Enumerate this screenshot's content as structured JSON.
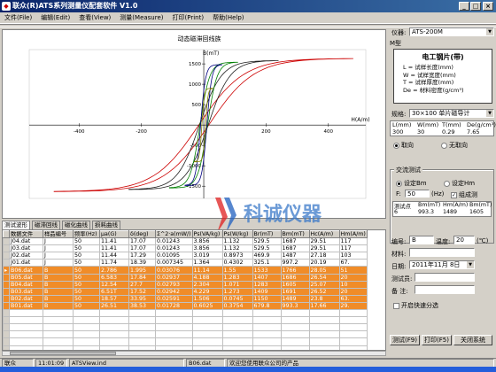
{
  "window": {
    "title": "联众(R)ATS系列测量仪配套软件 V1.0"
  },
  "menu": [
    "文件(File)",
    "编辑(Edit)",
    "查看(View)",
    "测量(Measure)",
    "打印(Print)",
    "帮助(Help)"
  ],
  "chart": {
    "title": "动态磁滞回线族",
    "y_axis_label": "B(mT)",
    "x_axis_label": "H(A/m)",
    "x_ticks": [
      "-400",
      "-200",
      "200",
      "400"
    ],
    "y_ticks": [
      "1500",
      "1000",
      "500",
      "-500",
      "-1000",
      "-1500"
    ]
  },
  "chart_data": {
    "type": "line",
    "title": "动态磁滞回线族",
    "xlabel": "H(A/m)",
    "ylabel": "B(mT)",
    "xlim": [
      -560,
      520
    ],
    "ylim": [
      -1800,
      1850
    ],
    "series": [
      {
        "Hm": 480,
        "Hc": 16,
        "Bm": 1630,
        "color": "#cc0000"
      },
      {
        "Hm": 240,
        "Hc": 14,
        "Bm": 1580,
        "color": "#202020"
      },
      {
        "Hm": 110,
        "Hc": 12,
        "Bm": 1540,
        "color": "#008000"
      },
      {
        "Hm": 60,
        "Hc": 10,
        "Bm": 1480,
        "color": "#000080"
      },
      {
        "Hm": 30,
        "Hc": 6,
        "Bm": 900,
        "color": "#808000"
      }
    ]
  },
  "watermark": {
    "brand": "科诚仪器",
    "company": "宁波北仑区科诚仪器有限公司"
  },
  "tabs": [
    "测试波形",
    "磁滞回线",
    "磁化曲线",
    "损耗曲线"
  ],
  "table": {
    "headers": [
      "数据文件",
      "样品编号",
      "频率(Hz)",
      "μa(G)",
      "δ(deg)",
      "Σ^2·a(mW/)",
      "Ps(VA/kg)",
      "Ps(W/kg)",
      "Br(mT)",
      "Bm(mT)",
      "Hc(A/m)",
      "Hm(A/m)"
    ],
    "rows": [
      [
        "J04.dat",
        "J",
        "50",
        "11.41",
        "17.07",
        "0.01243",
        "3.856",
        "1.132",
        "529.5",
        "1687",
        "29.51",
        "117"
      ],
      [
        "J03.dat",
        "J",
        "50",
        "11.41",
        "17.07",
        "0.01243",
        "3.856",
        "1.132",
        "529.5",
        "1687",
        "29.51",
        "117"
      ],
      [
        "J02.dat",
        "J",
        "50",
        "11.44",
        "17.29",
        "0.01095",
        "3.019",
        "0.8973",
        "469.9",
        "1487",
        "27.18",
        "103"
      ],
      [
        "J01.dat",
        "J",
        "50",
        "11.74",
        "18.39",
        "0.007345",
        "1.364",
        "0.4302",
        "325.1",
        "997.2",
        "20.19",
        "67."
      ],
      [
        "B06.dat",
        "B",
        "50",
        "2.786",
        "1.995",
        "0.03076",
        "11.14",
        "1.55",
        "1533",
        "1766",
        "28.05",
        "51"
      ],
      [
        "B05.dat",
        "B",
        "50",
        "6.583",
        "17.84",
        "0.02937",
        "4.188",
        "1.283",
        "1407",
        "1686",
        "26.54",
        "20"
      ],
      [
        "B04.dat",
        "B",
        "50",
        "12.54",
        "27.7",
        "0.02793",
        "2.304",
        "1.071",
        "1283",
        "1605",
        "25.07",
        "10"
      ],
      [
        "B03.dat",
        "B",
        "50",
        "6.51T",
        "17.52",
        "0.02942",
        "4.229",
        "1.273",
        "1409",
        "1691",
        "26.52",
        "20"
      ],
      [
        "B02.dat",
        "B",
        "50",
        "18.57",
        "33.95",
        "0.02591",
        "1.506",
        "0.0745",
        "1150",
        "1489",
        "23.8",
        "63."
      ],
      [
        "B01.dat",
        "B",
        "50",
        "26.51",
        "38.53",
        "0.01728",
        "0.6025",
        "0.3754",
        "679.8",
        "993.3",
        "17.66",
        "29."
      ]
    ],
    "selected_rows": [
      4,
      5,
      6,
      7,
      8,
      9
    ]
  },
  "right": {
    "instrument_label": "仪器:",
    "instrument_value": "ATS-200M",
    "section_label": "M型",
    "param_title": "电工钢片(带)",
    "param_lines": [
      "L = 试样长度(mm)",
      "W = 试样宽度(mm)",
      "T = 试样厚度(mm)",
      "De = 材料密度(g/cm³)"
    ],
    "spec_label": "规格:",
    "spec_value": "30×100 单片磁导计",
    "dim_headers": [
      "L(mm)",
      "W(mm)",
      "T(mm)",
      "De(g/cm³)"
    ],
    "dim_values": [
      "300",
      "30",
      "0.29",
      "7.65"
    ],
    "orient_options": [
      "取向",
      "无取向"
    ],
    "ac_group": "交流测试",
    "set_b": "设定Bm",
    "set_h": "设定Hm",
    "f_label": "F:",
    "f_value": "50",
    "f_unit": "(Hz)",
    "group_test": "组成测",
    "meas_headers": [
      "测试点",
      "Bm(mT)",
      "Hm(A/m)",
      "Bm(mT)"
    ],
    "meas_values": [
      "6",
      "993.3",
      "1489",
      "1605"
    ],
    "serial_label": "编号:",
    "serial_value": "B",
    "temp_label": "温度:",
    "temp_value": "20",
    "temp_unit": "(℃)",
    "material_label": "材料:",
    "date_label": "日期:",
    "date_value": "2011年11月 8日",
    "tester_label": "测试员:",
    "note_label": "备  注:",
    "fast_check": "开启快速分选",
    "btn_test": "测试(F9)",
    "btn_print": "打印(F5)",
    "btn_close": "关闭系统"
  },
  "status": {
    "app": "联众",
    "time": "11:01:09",
    "file": "ATSView.ind",
    "current": "B06.dat",
    "message": "欢迎您使用联众公司的产品"
  }
}
